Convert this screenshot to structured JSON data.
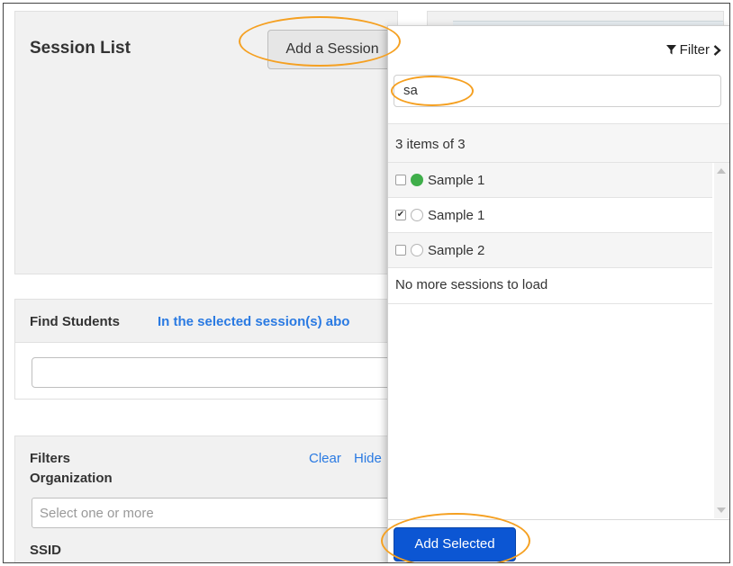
{
  "session_panel": {
    "title": "Session List",
    "add_button": "Add a Session"
  },
  "find_students": {
    "label": "Find Students",
    "scope_link": "In the selected session(s) abo",
    "input_value": ""
  },
  "filters": {
    "label": "Filters",
    "clear": "Clear",
    "hide": "Hide",
    "organization_label": "Organization",
    "organization_placeholder": "Select one or more",
    "ssid_label": "SSID"
  },
  "popover": {
    "filter_label": "Filter",
    "search_value": "sa",
    "count_text": "3 items of 3",
    "items": [
      {
        "label": "Sample 1",
        "checked": false,
        "status": "green"
      },
      {
        "label": "Sample 1",
        "checked": true,
        "status": "empty"
      },
      {
        "label": "Sample 2",
        "checked": false,
        "status": "empty"
      }
    ],
    "no_more": "No more sessions to load",
    "add_selected": "Add Selected"
  },
  "colors": {
    "accent_blue": "#0c56d3",
    "link_blue": "#2a7ae2",
    "status_green": "#3fae4a",
    "highlight_orange": "#f5a021"
  }
}
